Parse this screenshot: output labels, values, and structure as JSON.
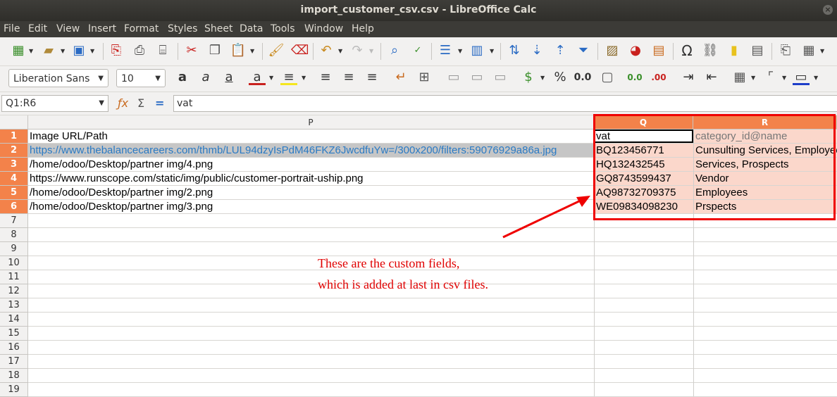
{
  "window": {
    "title": "import_customer_csv.csv - LibreOffice Calc"
  },
  "menu": [
    "File",
    "Edit",
    "View",
    "Insert",
    "Format",
    "Styles",
    "Sheet",
    "Data",
    "Tools",
    "Window",
    "Help"
  ],
  "toolbar2": {
    "font_name": "Liberation Sans",
    "font_size": "10",
    "percent": "%",
    "decimal": "0.0",
    "add_decimal": "0.0",
    "del_decimal": ".00"
  },
  "formula_bar": {
    "name_box": "Q1:R6",
    "function_symbol": "Σ",
    "equals": "=",
    "content": "vat"
  },
  "columns": {
    "P": "P",
    "Q": "Q",
    "R": "R"
  },
  "rows": [
    {
      "num": "1",
      "P": "Image URL/Path",
      "Q": "vat",
      "R": "category_id@name"
    },
    {
      "num": "2",
      "P": "https://www.thebalancecareers.com/thmb/LUL94dzyIsPdM46FKZ6JwcdfuYw=/300x200/filters:59076929a86a.jpg",
      "Q": "BQ123456771",
      "R": "Cunsulting Services, Employees"
    },
    {
      "num": "3",
      "P": "/home/odoo/Desktop/partner img/4.png",
      "Q": "HQ132432545",
      "R": "Services, Prospects"
    },
    {
      "num": "4",
      "P": "https://www.runscope.com/static/img/public/customer-portrait-uship.png",
      "Q": "GQ8743599437",
      "R": "Vendor"
    },
    {
      "num": "5",
      "P": "/home/odoo/Desktop/partner img/2.png",
      "Q": "AQ98732709375",
      "R": "Employees"
    },
    {
      "num": "6",
      "P": "/home/odoo/Desktop/partner img/3.png",
      "Q": "WE09834098230",
      "R": "Prspects"
    },
    {
      "num": "7",
      "P": "",
      "Q": "",
      "R": ""
    },
    {
      "num": "8",
      "P": "",
      "Q": "",
      "R": ""
    },
    {
      "num": "9",
      "P": "",
      "Q": "",
      "R": ""
    },
    {
      "num": "10",
      "P": "",
      "Q": "",
      "R": ""
    },
    {
      "num": "11",
      "P": "",
      "Q": "",
      "R": ""
    },
    {
      "num": "12",
      "P": "",
      "Q": "",
      "R": ""
    },
    {
      "num": "13",
      "P": "",
      "Q": "",
      "R": ""
    },
    {
      "num": "14",
      "P": "",
      "Q": "",
      "R": ""
    },
    {
      "num": "15",
      "P": "",
      "Q": "",
      "R": ""
    },
    {
      "num": "16",
      "P": "",
      "Q": "",
      "R": ""
    },
    {
      "num": "17",
      "P": "",
      "Q": "",
      "R": ""
    },
    {
      "num": "18",
      "P": "",
      "Q": "",
      "R": ""
    },
    {
      "num": "19",
      "P": "",
      "Q": "",
      "R": ""
    }
  ],
  "annotation": {
    "line1": "These are the custom fields,",
    "line2": "which is added at last in csv files.",
    "color": "#e00000"
  },
  "colors": {
    "selection_header": "#f3824a",
    "selection_fill": "#fbd7cb",
    "link": "#2a7ac4",
    "highlight_box": "#ef0000"
  }
}
